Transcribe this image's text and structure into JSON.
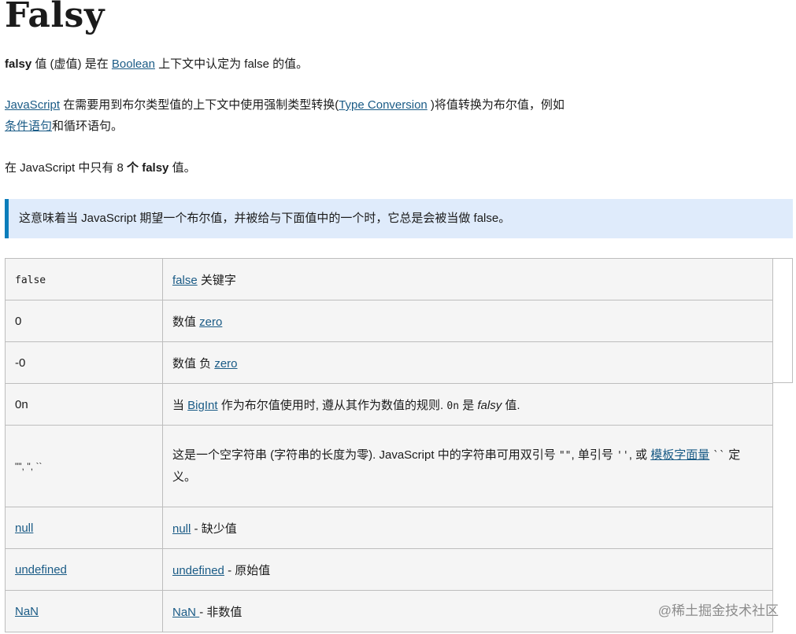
{
  "title": "Falsy",
  "intro": {
    "bold": "falsy",
    "text1": " 值 (虚值) 是在 ",
    "link": "Boolean",
    "text2": " 上下文中认定为 false 的值。"
  },
  "para2": {
    "link1": "JavaScript",
    "text1": " 在需要用到布尔类型值的上下文中使用强制类型转换(",
    "link2": "Type Conversion",
    "text2": " )将值转换为布尔值，例如",
    "link3": "条件语句",
    "text3": "和循环语句。"
  },
  "para3": {
    "text1": "在 JavaScript 中只有 8 ",
    "bold": "个 falsy",
    "text2": " 值。"
  },
  "note": "这意味着当 JavaScript 期望一个布尔值，并被给与下面值中的一个时，它总是会被当做 false。",
  "table": {
    "r1": {
      "value": "false",
      "link": "false",
      "desc": " 关键字"
    },
    "r2": {
      "value": "0",
      "pre": "数值 ",
      "link": "zero"
    },
    "r3": {
      "value": "-0",
      "pre": "数值 负 ",
      "link": "zero"
    },
    "r4": {
      "value": "0n",
      "pre": "当 ",
      "link": "BigInt",
      "mid": " 作为布尔值使用时, 遵从其作为数值的规则. ",
      "code": "0n",
      "post1": " 是 ",
      "italic": "falsy",
      "post2": " 值."
    },
    "r5": {
      "value": "\"\", '', ``",
      "text1": "这是一个空字符串 (字符串的长度为零). JavaScript 中的字符串可用双引号 ",
      "code1": "\"\"",
      "text2": ", 单引号 ",
      "code2": "''",
      "text3": ", 或 ",
      "link": "模板字面量",
      "code3": "``",
      "text4": " 定义。"
    },
    "r6": {
      "value": "null",
      "link": "null",
      "desc": " - 缺少值"
    },
    "r7": {
      "value": "undefined",
      "link": "undefined",
      "desc": " - 原始值"
    },
    "r8": {
      "value": "NaN",
      "link": "NaN ",
      "desc": "- 非数值"
    }
  },
  "watermark": "@稀土掘金技术社区"
}
